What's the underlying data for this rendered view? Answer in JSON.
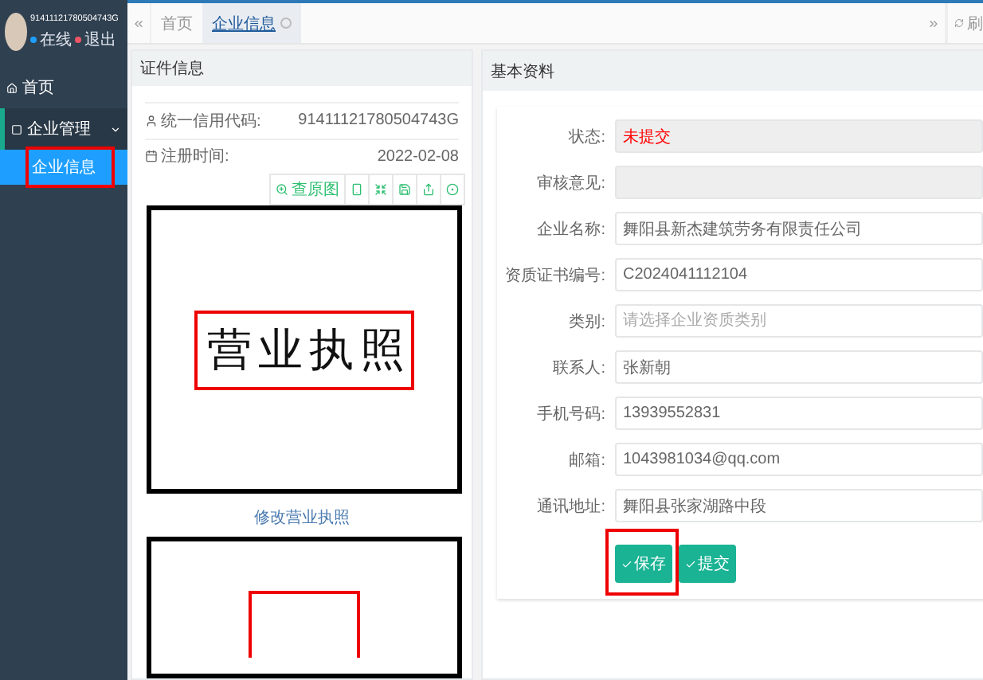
{
  "sidebar": {
    "user": {
      "name": "91411121780504743G",
      "status": "在线",
      "logout": "退出"
    },
    "items": [
      {
        "label": "首页",
        "kind": "link",
        "selected": false
      },
      {
        "label": "企业管理",
        "kind": "group",
        "expanded": true,
        "selected": false,
        "children": [
          {
            "label": "企业信息",
            "selected": true,
            "highlighted": true
          }
        ]
      }
    ]
  },
  "tabs": {
    "items": [
      {
        "label": "首页",
        "selected": false,
        "closable": false
      },
      {
        "label": "企业信息",
        "selected": true,
        "closable": true
      }
    ],
    "refresh": "刷"
  },
  "cert_panel": {
    "title": "证件信息",
    "rows": [
      {
        "label": "统一信用代码:",
        "value": "91411121780504743G",
        "kind": "person"
      },
      {
        "label": "注册时间:",
        "value": "2022-02-08",
        "kind": "calendar"
      }
    ],
    "viewer_toolbar": {
      "label": "查原图"
    },
    "images": [
      {
        "caption": "营业执照"
      },
      {
        "kind": "cropped"
      }
    ],
    "change_link": "修改营业执照"
  },
  "info_panel": {
    "title": "基本资料",
    "fields": [
      {
        "label": "状态:",
        "value": "未提交",
        "kind": "status"
      },
      {
        "label": "审核意见:",
        "kind": "readonly"
      },
      {
        "label": "企业名称:",
        "value": "舞阳县新杰建筑劳务有限责任公司",
        "kind": "input"
      },
      {
        "label": "资质证书编号:",
        "value": "C2024041112104",
        "kind": "input"
      },
      {
        "label": "类别:",
        "placeholder": "请选择企业资质类别",
        "kind": "input"
      },
      {
        "label": "联系人:",
        "value": "张新朝",
        "kind": "input"
      },
      {
        "label": "手机号码:",
        "value": "13939552831",
        "kind": "input"
      },
      {
        "label": "邮箱:",
        "value": "1043981034@qq.com",
        "kind": "input"
      },
      {
        "label": "通讯地址:",
        "value": "舞阳县张家湖路中段",
        "kind": "input"
      }
    ],
    "buttons": [
      {
        "label": "保存",
        "highlighted": true
      },
      {
        "label": "提交",
        "highlighted": false
      }
    ]
  }
}
